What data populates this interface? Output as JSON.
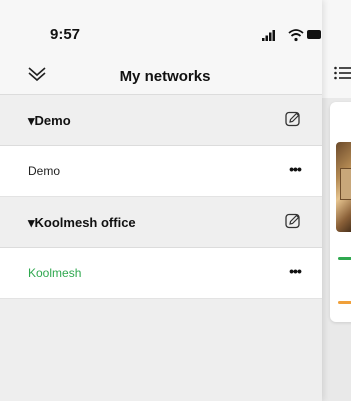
{
  "status_bar": {
    "time": "9:57"
  },
  "header": {
    "title": "My networks",
    "collapse_icon": "double-chevron-down-icon"
  },
  "groups": [
    {
      "title": "▾Demo",
      "networks": [
        {
          "name": "Demo",
          "more": "•••"
        }
      ]
    },
    {
      "title": "▾Koolmesh office",
      "networks": [
        {
          "name": "Koolmesh",
          "more": "•••",
          "active": true
        }
      ]
    }
  ],
  "colors": {
    "active_network": "#2fa84f",
    "accent_orange": "#f0a03a"
  }
}
